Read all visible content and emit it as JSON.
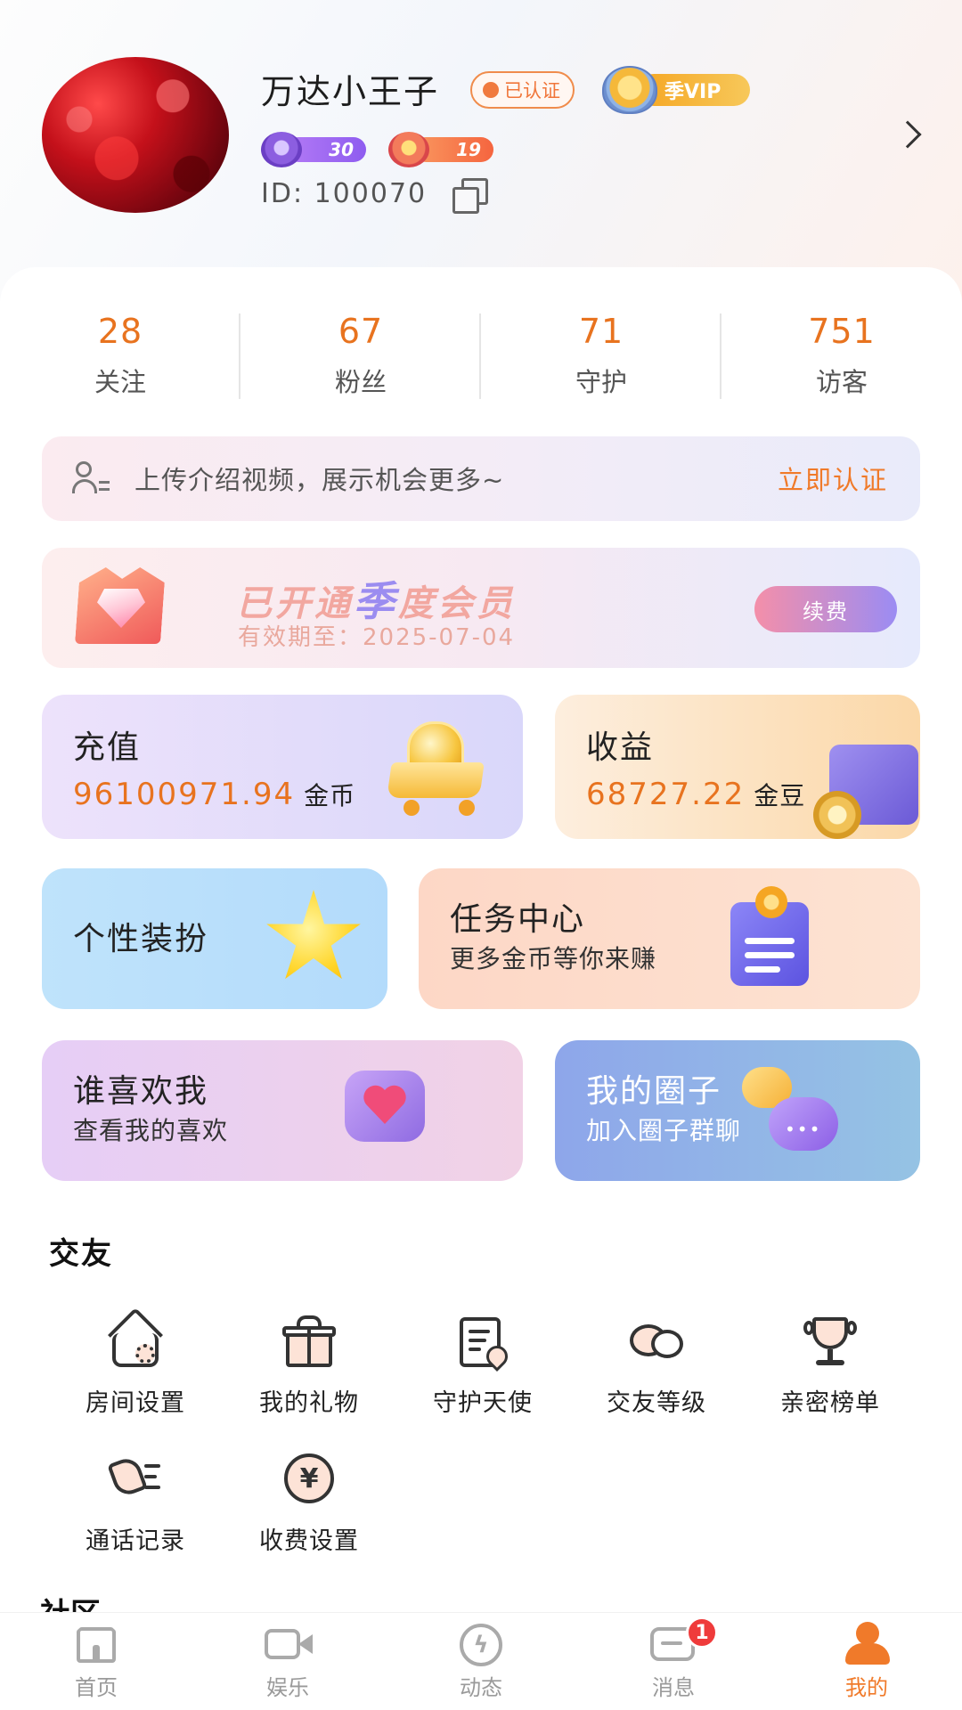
{
  "profile": {
    "name": "万达小王子",
    "verified_label": "已认证",
    "vip_label": "季VIP",
    "level_a": "30",
    "level_b": "19",
    "id_text": "ID:  100070"
  },
  "stats": [
    {
      "value": "28",
      "label": "关注"
    },
    {
      "value": "67",
      "label": "粉丝"
    },
    {
      "value": "71",
      "label": "守护"
    },
    {
      "value": "751",
      "label": "访客"
    }
  ],
  "upload_banner": {
    "text": "上传介绍视频，展示机会更多~",
    "cta": "立即认证"
  },
  "vip_card": {
    "title_prefix": "已开通",
    "title_em": "季",
    "title_suffix": "度会员",
    "expiry": "有效期至：2025-07-04",
    "renew": "续费"
  },
  "tiles": {
    "recharge": {
      "title": "充值",
      "amount": "96100971.94",
      "unit": "金币"
    },
    "income": {
      "title": "收益",
      "amount": "68727.22",
      "unit": "金豆"
    },
    "dress": {
      "title": "个性装扮"
    },
    "task": {
      "title": "任务中心",
      "subtitle": "更多金币等你来赚"
    },
    "likes": {
      "title": "谁喜欢我",
      "subtitle": "查看我的喜欢"
    },
    "circle": {
      "title": "我的圈子",
      "subtitle": "加入圈子群聊"
    }
  },
  "friends_section": {
    "title": "交友",
    "items": [
      {
        "label": "房间设置",
        "icon": "room-settings-icon"
      },
      {
        "label": "我的礼物",
        "icon": "gift-icon"
      },
      {
        "label": "守护天使",
        "icon": "guardian-icon"
      },
      {
        "label": "交友等级",
        "icon": "chat-level-icon"
      },
      {
        "label": "亲密榜单",
        "icon": "trophy-icon"
      },
      {
        "label": "通话记录",
        "icon": "call-log-icon"
      },
      {
        "label": "收费设置",
        "icon": "yen-icon"
      }
    ]
  },
  "next_section_title": "社区",
  "tabbar": {
    "items": [
      {
        "label": "首页",
        "icon": "home-icon"
      },
      {
        "label": "娱乐",
        "icon": "video-icon"
      },
      {
        "label": "动态",
        "icon": "bolt-icon"
      },
      {
        "label": "消息",
        "icon": "message-icon",
        "badge": "1"
      },
      {
        "label": "我的",
        "icon": "person-icon",
        "active": true
      }
    ]
  },
  "colors": {
    "accent": "#f07a2a",
    "amount": "#e8731f",
    "badge": "#ef3b3b"
  }
}
